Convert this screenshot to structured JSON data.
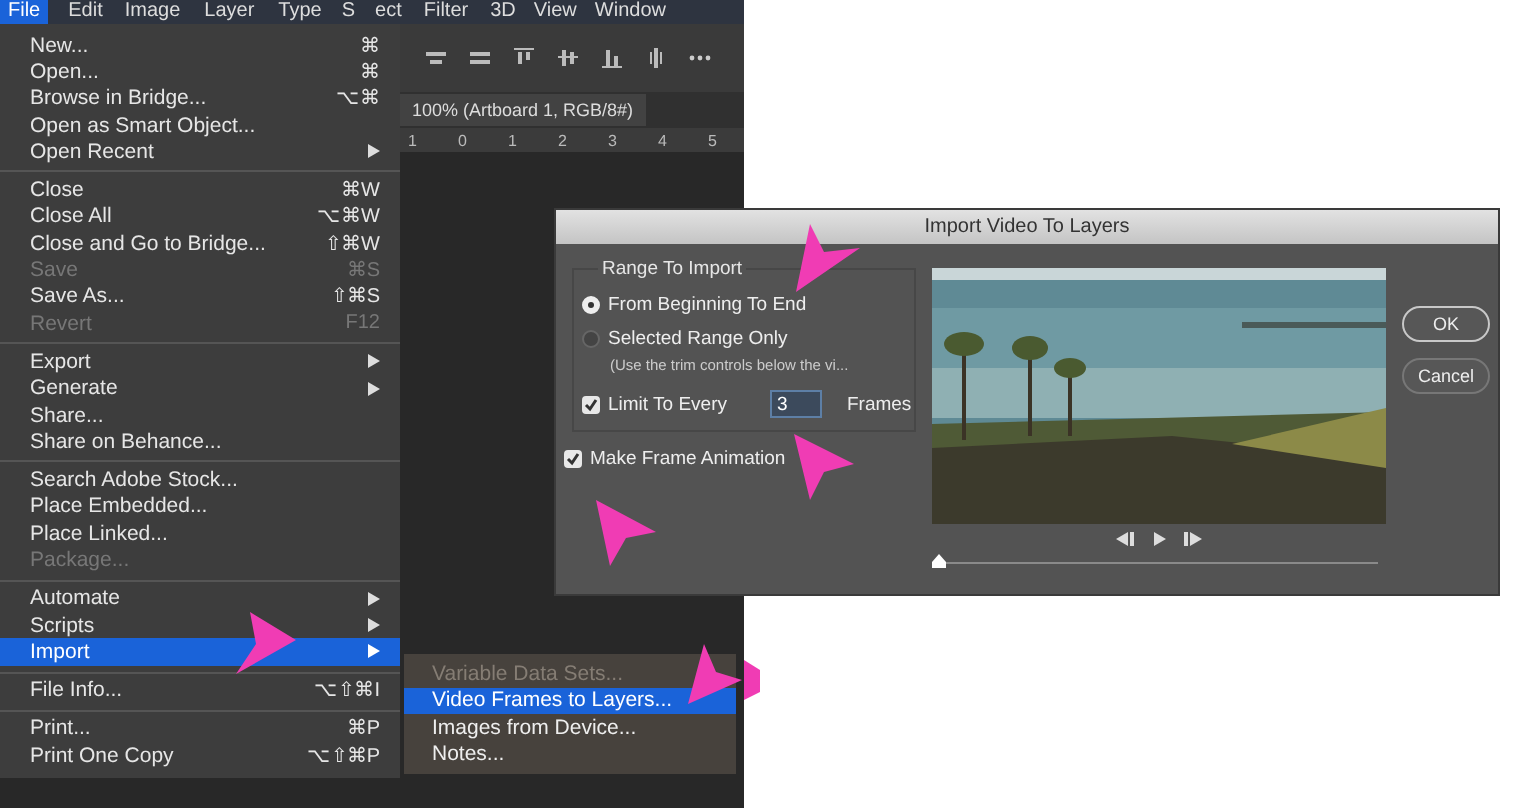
{
  "menubar": [
    {
      "label": "File",
      "selected": true
    },
    {
      "label": "Edit",
      "selected": false
    },
    {
      "label": "Image",
      "selected": false
    },
    {
      "label": "Layer",
      "selected": false
    },
    {
      "label": "Type",
      "selected": false
    },
    {
      "label": "S",
      "selected": false
    },
    {
      "label": "ect",
      "selected": false
    },
    {
      "label": "Filter",
      "selected": false
    },
    {
      "label": "3D",
      "selected": false
    },
    {
      "label": "View",
      "selected": false
    },
    {
      "label": "Window",
      "selected": false
    }
  ],
  "document_tab": "100% (Artboard 1, RGB/8#)",
  "ruler_labels": [
    "1",
    "0",
    "1",
    "2",
    "3",
    "4",
    "5"
  ],
  "file_menu": [
    [
      {
        "label": "New...",
        "shortcut": "⌘",
        "submenu": false,
        "disabled": false,
        "selected": false
      },
      {
        "label": "Open...",
        "shortcut": "⌘",
        "submenu": false,
        "disabled": false,
        "selected": false
      },
      {
        "label": "Browse in Bridge...",
        "shortcut": "⌥⌘",
        "submenu": false,
        "disabled": false,
        "selected": false
      },
      {
        "label": "Open as Smart Object...",
        "submenu": false,
        "disabled": false,
        "selected": false
      },
      {
        "label": "Open Recent",
        "submenu": true,
        "disabled": false,
        "selected": false
      }
    ],
    [
      {
        "label": "Close",
        "shortcut": "⌘W",
        "submenu": false,
        "disabled": false,
        "selected": false
      },
      {
        "label": "Close All",
        "shortcut": "⌥⌘W",
        "submenu": false,
        "disabled": false,
        "selected": false
      },
      {
        "label": "Close and Go to Bridge...",
        "shortcut": "⇧⌘W",
        "submenu": false,
        "disabled": false,
        "selected": false
      },
      {
        "label": "Save",
        "shortcut": "⌘S",
        "submenu": false,
        "disabled": true,
        "selected": false
      },
      {
        "label": "Save As...",
        "shortcut": "⇧⌘S",
        "submenu": false,
        "disabled": false,
        "selected": false
      },
      {
        "label": "Revert",
        "shortcut": "F12",
        "submenu": false,
        "disabled": true,
        "selected": false
      }
    ],
    [
      {
        "label": "Export",
        "submenu": true,
        "disabled": false,
        "selected": false
      },
      {
        "label": "Generate",
        "submenu": true,
        "disabled": false,
        "selected": false
      },
      {
        "label": "Share...",
        "submenu": false,
        "disabled": false,
        "selected": false
      },
      {
        "label": "Share on Behance...",
        "submenu": false,
        "disabled": false,
        "selected": false
      }
    ],
    [
      {
        "label": "Search Adobe Stock...",
        "submenu": false,
        "disabled": false,
        "selected": false
      },
      {
        "label": "Place Embedded...",
        "submenu": false,
        "disabled": false,
        "selected": false
      },
      {
        "label": "Place Linked...",
        "submenu": false,
        "disabled": false,
        "selected": false
      },
      {
        "label": "Package...",
        "submenu": false,
        "disabled": true,
        "selected": false
      }
    ],
    [
      {
        "label": "Automate",
        "submenu": true,
        "disabled": false,
        "selected": false
      },
      {
        "label": "Scripts",
        "submenu": true,
        "disabled": false,
        "selected": false
      },
      {
        "label": "Import",
        "submenu": true,
        "disabled": false,
        "selected": true
      }
    ],
    [
      {
        "label": "File Info...",
        "shortcut": "⌥⇧⌘I",
        "submenu": false,
        "disabled": false,
        "selected": false
      }
    ],
    [
      {
        "label": "Print...",
        "shortcut": "⌘P",
        "submenu": false,
        "disabled": false,
        "selected": false
      },
      {
        "label": "Print One Copy",
        "shortcut": "⌥⇧⌘P",
        "submenu": false,
        "disabled": false,
        "selected": false
      }
    ]
  ],
  "import_submenu": [
    {
      "label": "Variable Data Sets...",
      "disabled": true,
      "selected": false
    },
    {
      "label": "Video Frames to Layers...",
      "disabled": false,
      "selected": true
    },
    {
      "label": "Images from Device...",
      "disabled": false,
      "selected": false
    },
    {
      "label": "Notes...",
      "disabled": false,
      "selected": false
    }
  ],
  "dialog": {
    "title": "Import Video To Layers",
    "group_title": "Range To Import",
    "range_options": [
      {
        "label": "From Beginning To End",
        "selected": true
      },
      {
        "label": "Selected Range Only",
        "selected": false,
        "hint": "(Use the trim controls below the vi..."
      }
    ],
    "limit": {
      "label": "Limit To Every",
      "checked": true,
      "value": "3",
      "unit": "Frames"
    },
    "make_animation": {
      "label": "Make Frame Animation",
      "checked": true
    },
    "preview": {
      "kind": "picture"
    },
    "trim": {
      "level": 0
    },
    "buttons": [
      "OK",
      "Cancel"
    ]
  }
}
